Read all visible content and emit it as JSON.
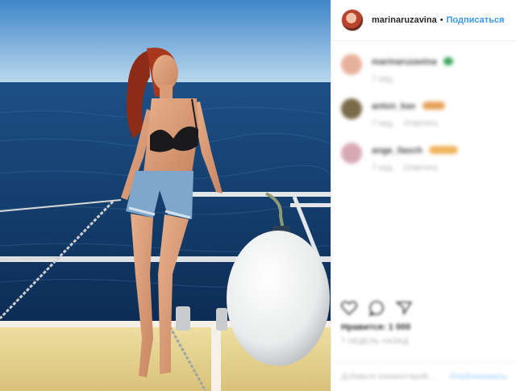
{
  "post": {
    "username": "marinaruzavina",
    "separator": "•",
    "follow_label": "Подписаться",
    "photo_alt": "photo"
  },
  "comments": [
    {
      "user": "marinaruzavina",
      "meta_time": "7 нед.",
      "meta_reply": "",
      "emoji_color": "#3aa35a"
    },
    {
      "user": "anton_kav",
      "meta_time": "7 нед.",
      "meta_reply": "Ответить",
      "emoji_color": "#e6a25b"
    },
    {
      "user": "ange_liasch",
      "meta_time": "7 нед.",
      "meta_reply": "Ответить",
      "emoji_color": "#f0b35c"
    }
  ],
  "actions": {
    "likes_text": "Нравится: 1 000",
    "date_text": "7 НЕДЕЛЬ НАЗАД",
    "comment_placeholder": "Добавьте комментарий...",
    "publish_label": "Опубликовать"
  },
  "icons": {
    "heart": "heart-icon",
    "comment": "comment-icon",
    "share": "share-icon"
  },
  "colors": {
    "accent": "#3897f0",
    "sky_top": "#3f86c9",
    "sea": "#10345f"
  }
}
